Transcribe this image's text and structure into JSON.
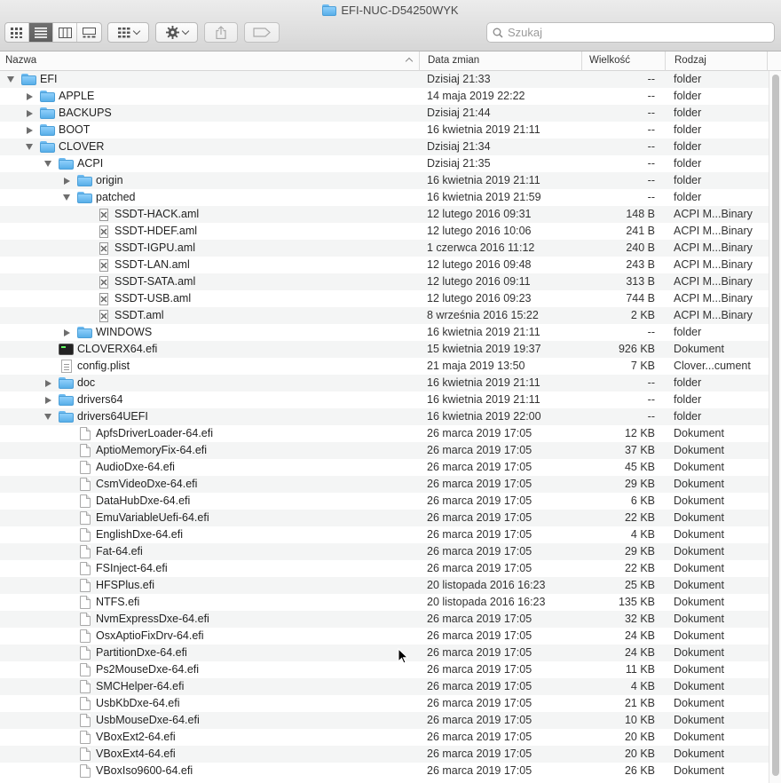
{
  "window": {
    "title": "EFI-NUC-D54250WYK",
    "search_placeholder": "Szukaj"
  },
  "toolbar": {
    "view_buttons": [
      "icon-view-icon",
      "list-view-icon",
      "column-view-icon",
      "gallery-view-icon"
    ],
    "active_view": "list-view-icon",
    "arrange_icon": "arrange-grid-icon",
    "action_icon": "gear-icon",
    "share_icon": "share-icon",
    "tag_icon": "tag-icon"
  },
  "columns": {
    "name": "Nazwa",
    "date": "Data zmian",
    "size": "Wielkość",
    "kind": "Rodzaj"
  },
  "rows": [
    {
      "name": "EFI",
      "date": "Dzisiaj 21:33",
      "size": "--",
      "kind": "folder",
      "icon": "folder",
      "level": 0,
      "disc": "open"
    },
    {
      "name": "APPLE",
      "date": "14 maja 2019 22:22",
      "size": "--",
      "kind": "folder",
      "icon": "folder",
      "level": 1,
      "disc": "closed"
    },
    {
      "name": "BACKUPS",
      "date": "Dzisiaj 21:44",
      "size": "--",
      "kind": "folder",
      "icon": "folder",
      "level": 1,
      "disc": "closed"
    },
    {
      "name": "BOOT",
      "date": "16 kwietnia 2019 21:11",
      "size": "--",
      "kind": "folder",
      "icon": "folder",
      "level": 1,
      "disc": "closed"
    },
    {
      "name": "CLOVER",
      "date": "Dzisiaj 21:34",
      "size": "--",
      "kind": "folder",
      "icon": "folder",
      "level": 1,
      "disc": "open"
    },
    {
      "name": "ACPI",
      "date": "Dzisiaj 21:35",
      "size": "--",
      "kind": "folder",
      "icon": "folder",
      "level": 2,
      "disc": "open"
    },
    {
      "name": "origin",
      "date": "16 kwietnia 2019 21:11",
      "size": "--",
      "kind": "folder",
      "icon": "folder",
      "level": 3,
      "disc": "closed"
    },
    {
      "name": "patched",
      "date": "16 kwietnia 2019 21:59",
      "size": "--",
      "kind": "folder",
      "icon": "folder",
      "level": 3,
      "disc": "open"
    },
    {
      "name": "SSDT-HACK.aml",
      "date": "12 lutego 2016 09:31",
      "size": "148 B",
      "kind": "ACPI M...Binary",
      "icon": "aml",
      "level": 4,
      "disc": "none"
    },
    {
      "name": "SSDT-HDEF.aml",
      "date": "12 lutego 2016 10:06",
      "size": "241 B",
      "kind": "ACPI M...Binary",
      "icon": "aml",
      "level": 4,
      "disc": "none"
    },
    {
      "name": "SSDT-IGPU.aml",
      "date": "1 czerwca 2016 11:12",
      "size": "240 B",
      "kind": "ACPI M...Binary",
      "icon": "aml",
      "level": 4,
      "disc": "none"
    },
    {
      "name": "SSDT-LAN.aml",
      "date": "12 lutego 2016 09:48",
      "size": "243 B",
      "kind": "ACPI M...Binary",
      "icon": "aml",
      "level": 4,
      "disc": "none"
    },
    {
      "name": "SSDT-SATA.aml",
      "date": "12 lutego 2016 09:11",
      "size": "313 B",
      "kind": "ACPI M...Binary",
      "icon": "aml",
      "level": 4,
      "disc": "none"
    },
    {
      "name": "SSDT-USB.aml",
      "date": "12 lutego 2016 09:23",
      "size": "744 B",
      "kind": "ACPI M...Binary",
      "icon": "aml",
      "level": 4,
      "disc": "none"
    },
    {
      "name": "SSDT.aml",
      "date": "8 września 2016 15:22",
      "size": "2 KB",
      "kind": "ACPI M...Binary",
      "icon": "aml",
      "level": 4,
      "disc": "none"
    },
    {
      "name": "WINDOWS",
      "date": "16 kwietnia 2019 21:11",
      "size": "--",
      "kind": "folder",
      "icon": "folder",
      "level": 3,
      "disc": "closed"
    },
    {
      "name": "CLOVERX64.efi",
      "date": "15 kwietnia 2019 19:37",
      "size": "926 KB",
      "kind": "Dokument",
      "icon": "exe",
      "level": 2,
      "disc": "none"
    },
    {
      "name": "config.plist",
      "date": "21 maja 2019 13:50",
      "size": "7 KB",
      "kind": "Clover...cument",
      "icon": "plist",
      "level": 2,
      "disc": "none"
    },
    {
      "name": "doc",
      "date": "16 kwietnia 2019 21:11",
      "size": "--",
      "kind": "folder",
      "icon": "folder",
      "level": 2,
      "disc": "closed"
    },
    {
      "name": "drivers64",
      "date": "16 kwietnia 2019 21:11",
      "size": "--",
      "kind": "folder",
      "icon": "folder",
      "level": 2,
      "disc": "closed"
    },
    {
      "name": "drivers64UEFI",
      "date": "16 kwietnia 2019 22:00",
      "size": "--",
      "kind": "folder",
      "icon": "folder",
      "level": 2,
      "disc": "open"
    },
    {
      "name": "ApfsDriverLoader-64.efi",
      "date": "26 marca 2019 17:05",
      "size": "12 KB",
      "kind": "Dokument",
      "icon": "doc",
      "level": 3,
      "disc": "none"
    },
    {
      "name": "AptioMemoryFix-64.efi",
      "date": "26 marca 2019 17:05",
      "size": "37 KB",
      "kind": "Dokument",
      "icon": "doc",
      "level": 3,
      "disc": "none"
    },
    {
      "name": "AudioDxe-64.efi",
      "date": "26 marca 2019 17:05",
      "size": "45 KB",
      "kind": "Dokument",
      "icon": "doc",
      "level": 3,
      "disc": "none"
    },
    {
      "name": "CsmVideoDxe-64.efi",
      "date": "26 marca 2019 17:05",
      "size": "29 KB",
      "kind": "Dokument",
      "icon": "doc",
      "level": 3,
      "disc": "none"
    },
    {
      "name": "DataHubDxe-64.efi",
      "date": "26 marca 2019 17:05",
      "size": "6 KB",
      "kind": "Dokument",
      "icon": "doc",
      "level": 3,
      "disc": "none"
    },
    {
      "name": "EmuVariableUefi-64.efi",
      "date": "26 marca 2019 17:05",
      "size": "22 KB",
      "kind": "Dokument",
      "icon": "doc",
      "level": 3,
      "disc": "none"
    },
    {
      "name": "EnglishDxe-64.efi",
      "date": "26 marca 2019 17:05",
      "size": "4 KB",
      "kind": "Dokument",
      "icon": "doc",
      "level": 3,
      "disc": "none"
    },
    {
      "name": "Fat-64.efi",
      "date": "26 marca 2019 17:05",
      "size": "29 KB",
      "kind": "Dokument",
      "icon": "doc",
      "level": 3,
      "disc": "none"
    },
    {
      "name": "FSInject-64.efi",
      "date": "26 marca 2019 17:05",
      "size": "22 KB",
      "kind": "Dokument",
      "icon": "doc",
      "level": 3,
      "disc": "none"
    },
    {
      "name": "HFSPlus.efi",
      "date": "20 listopada 2016 16:23",
      "size": "25 KB",
      "kind": "Dokument",
      "icon": "doc",
      "level": 3,
      "disc": "none"
    },
    {
      "name": "NTFS.efi",
      "date": "20 listopada 2016 16:23",
      "size": "135 KB",
      "kind": "Dokument",
      "icon": "doc",
      "level": 3,
      "disc": "none"
    },
    {
      "name": "NvmExpressDxe-64.efi",
      "date": "26 marca 2019 17:05",
      "size": "32 KB",
      "kind": "Dokument",
      "icon": "doc",
      "level": 3,
      "disc": "none"
    },
    {
      "name": "OsxAptioFixDrv-64.efi",
      "date": "26 marca 2019 17:05",
      "size": "24 KB",
      "kind": "Dokument",
      "icon": "doc",
      "level": 3,
      "disc": "none"
    },
    {
      "name": "PartitionDxe-64.efi",
      "date": "26 marca 2019 17:05",
      "size": "24 KB",
      "kind": "Dokument",
      "icon": "doc",
      "level": 3,
      "disc": "none"
    },
    {
      "name": "Ps2MouseDxe-64.efi",
      "date": "26 marca 2019 17:05",
      "size": "11 KB",
      "kind": "Dokument",
      "icon": "doc",
      "level": 3,
      "disc": "none"
    },
    {
      "name": "SMCHelper-64.efi",
      "date": "26 marca 2019 17:05",
      "size": "4 KB",
      "kind": "Dokument",
      "icon": "doc",
      "level": 3,
      "disc": "none"
    },
    {
      "name": "UsbKbDxe-64.efi",
      "date": "26 marca 2019 17:05",
      "size": "21 KB",
      "kind": "Dokument",
      "icon": "doc",
      "level": 3,
      "disc": "none"
    },
    {
      "name": "UsbMouseDxe-64.efi",
      "date": "26 marca 2019 17:05",
      "size": "10 KB",
      "kind": "Dokument",
      "icon": "doc",
      "level": 3,
      "disc": "none"
    },
    {
      "name": "VBoxExt2-64.efi",
      "date": "26 marca 2019 17:05",
      "size": "20 KB",
      "kind": "Dokument",
      "icon": "doc",
      "level": 3,
      "disc": "none"
    },
    {
      "name": "VBoxExt4-64.efi",
      "date": "26 marca 2019 17:05",
      "size": "20 KB",
      "kind": "Dokument",
      "icon": "doc",
      "level": 3,
      "disc": "none"
    },
    {
      "name": "VBoxIso9600-64.efi",
      "date": "26 marca 2019 17:05",
      "size": "26 KB",
      "kind": "Dokument",
      "icon": "doc",
      "level": 3,
      "disc": "none"
    }
  ],
  "colors": {
    "folder": "#58aee8",
    "row_alt": "#f4f5f5",
    "toolbar_top": "#ececec",
    "toolbar_bottom": "#d6d6d6"
  }
}
